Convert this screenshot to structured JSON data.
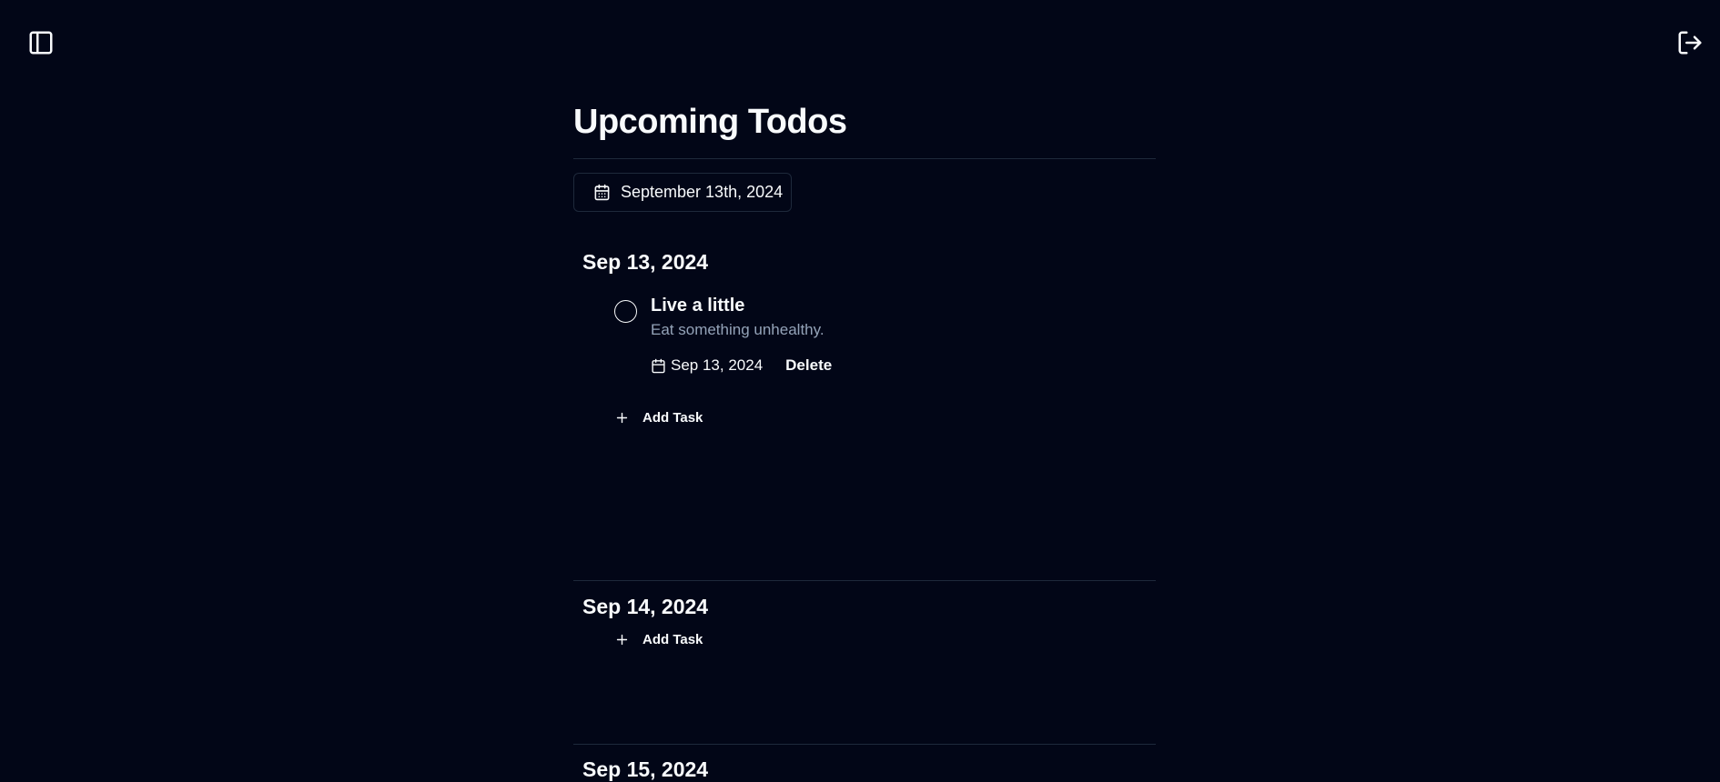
{
  "topbar": {
    "sidebar_toggle_icon": "panel-left-icon",
    "logout_icon": "log-out-icon"
  },
  "page": {
    "title": "Upcoming Todos"
  },
  "date_picker": {
    "icon": "calendar-icon",
    "value": "September 13th, 2024"
  },
  "days": [
    {
      "heading": "Sep 13, 2024",
      "tasks": [
        {
          "title": "Live a little",
          "description": "Eat something unhealthy.",
          "due_date": "Sep 13, 2024",
          "delete_label": "Delete"
        }
      ],
      "add_task_label": "Add Task"
    },
    {
      "heading": "Sep 14, 2024",
      "tasks": [],
      "add_task_label": "Add Task"
    },
    {
      "heading": "Sep 15, 2024",
      "tasks": []
    }
  ],
  "colors": {
    "background": "#020617",
    "text": "#f8fafc",
    "muted_text": "#94a3b8",
    "border": "#1e293b"
  }
}
